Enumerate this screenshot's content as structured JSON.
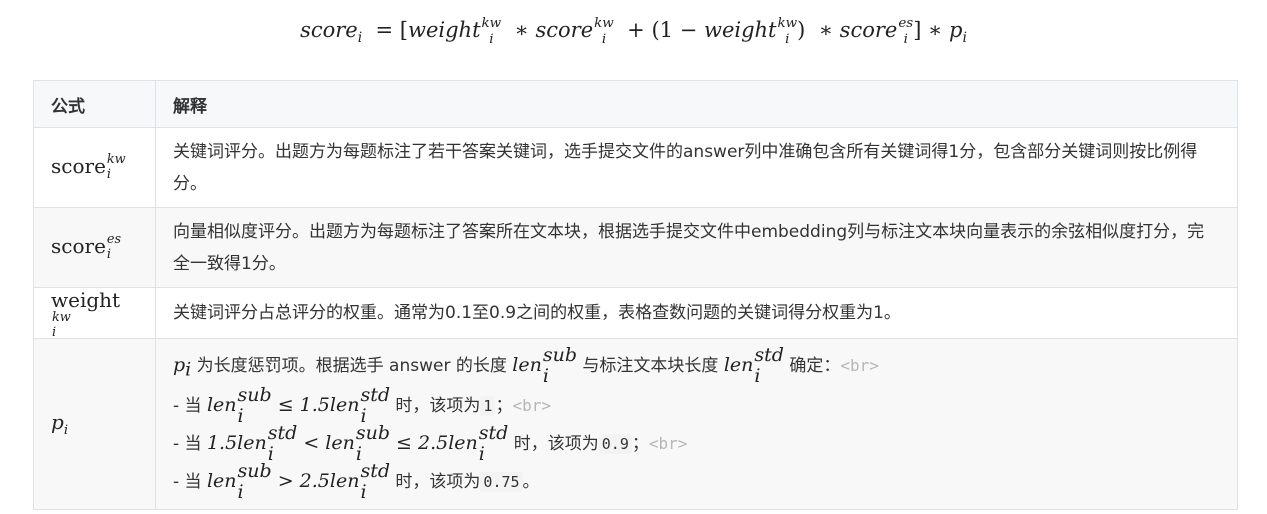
{
  "formula": {
    "lhs": "score",
    "weight": "weight",
    "score": "score",
    "sub_i": "i",
    "sup_kw": "kw",
    "sup_es": "es",
    "p": "p",
    "one": "1"
  },
  "table": {
    "headers": [
      "公式",
      "解释"
    ],
    "rows": [
      {
        "symbol_base": "score",
        "symbol_sup": "kw",
        "symbol_sub": "i",
        "desc": "关键词评分。出题方为每题标注了若干答案关键词，选手提交文件的answer列中准确包含所有关键词得1分，包含部分关键词则按比例得分。"
      },
      {
        "symbol_base": "score",
        "symbol_sup": "es",
        "symbol_sub": "i",
        "desc": "向量相似度评分。出题方为每题标注了答案所在文本块，根据选手提交文件中embedding列与标注文本块向量表示的余弦相似度打分，完全一致得1分。"
      },
      {
        "symbol_base": "weight",
        "symbol_sup": "kw",
        "symbol_sub": "i",
        "desc": "关键词评分占总评分的权重。通常为0.1至0.9之间的权重，表格查数问题的关键词得分权重为1。"
      },
      {
        "symbol_base": "p",
        "symbol_sub": "i",
        "p_line1_a": "为长度惩罚项。根据选手 answer 的长度",
        "p_line1_b": "与标注文本块长度",
        "p_line1_c": "确定：",
        "br_tag": "<br>",
        "dash_when": "- 当",
        "then_text": "时，该项为",
        "semi": "；",
        "period": "。",
        "len": "len",
        "sup_sub": "sub",
        "sup_std": "std",
        "c15": "1.5",
        "c25": "2.5",
        "val1": "1",
        "val2": "0.9",
        "val3": "0.75"
      }
    ]
  }
}
